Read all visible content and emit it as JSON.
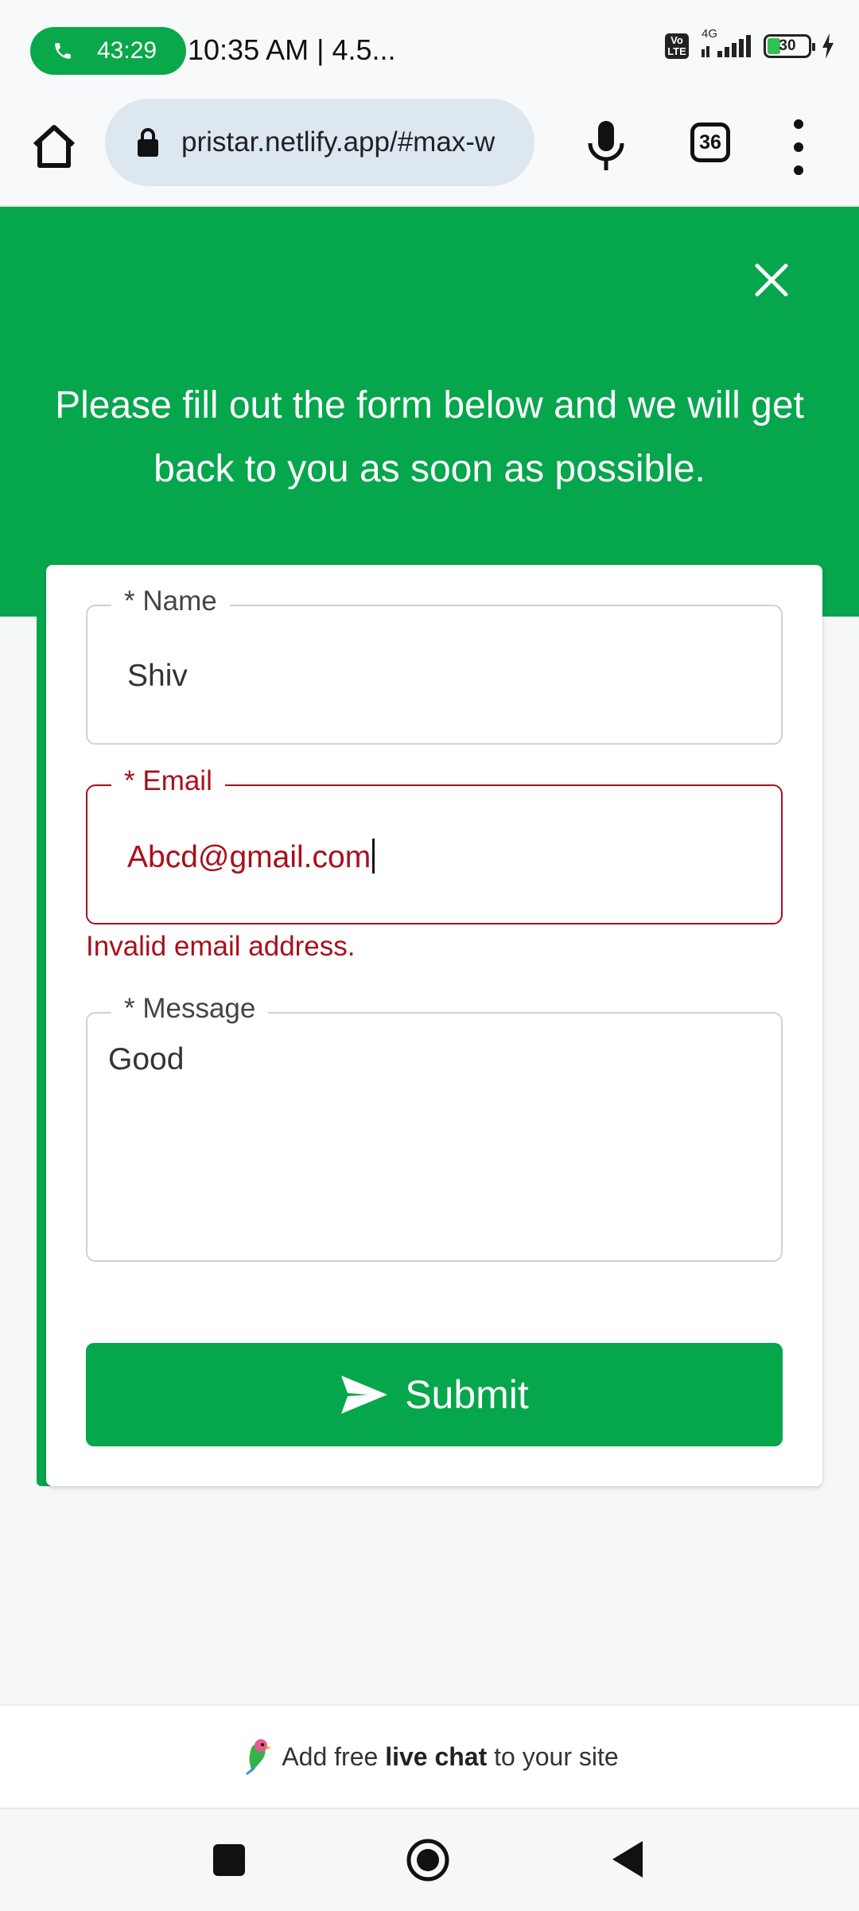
{
  "status_bar": {
    "call_time": "43:29",
    "time_text": "10:35 AM | 4.5...",
    "volte_label": "Vo LTE",
    "network_label": "4G",
    "battery_level": "30"
  },
  "browser": {
    "url": "pristar.netlify.app/#max-w",
    "tab_count": "36"
  },
  "header": {
    "message": "Please fill out the form below and we will get back to you as soon as possible."
  },
  "form": {
    "name": {
      "label": "* Name",
      "value": "Shiv"
    },
    "email": {
      "label": "* Email",
      "value": "Abcd@gmail.com",
      "error": "Invalid email address."
    },
    "message": {
      "label": "* Message",
      "value": "Good"
    },
    "submit_label": "Submit"
  },
  "promo": {
    "prefix": "Add free ",
    "bold": "live chat",
    "suffix": " to your site"
  },
  "colors": {
    "brand_green": "#06a64c",
    "error_red": "#a8101c"
  }
}
